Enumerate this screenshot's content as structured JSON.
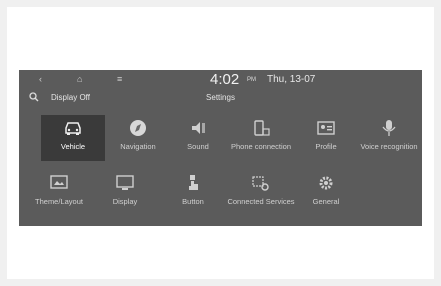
{
  "status": {
    "back_icon": "back-icon",
    "home_icon": "home-icon",
    "menu_icon": "menu-icon",
    "time": "4:02",
    "ampm": "PM",
    "date": "Thu, 13-07"
  },
  "header": {
    "search_icon": "search-icon",
    "display_off": "Display Off",
    "title": "Settings"
  },
  "tiles": [
    {
      "label": "Vehicle",
      "icon": "car-icon",
      "selected": true
    },
    {
      "label": "Navigation",
      "icon": "compass-icon"
    },
    {
      "label": "Sound",
      "icon": "speaker-icon"
    },
    {
      "label": "Phone connection",
      "icon": "phone-icon"
    },
    {
      "label": "Profile",
      "icon": "profile-icon"
    },
    {
      "label": "Voice recognition",
      "icon": "microphone-icon"
    },
    {
      "label": "Theme/Layout",
      "icon": "theme-icon"
    },
    {
      "label": "Display",
      "icon": "display-icon"
    },
    {
      "label": "Button",
      "icon": "button-icon"
    },
    {
      "label": "Connected Services",
      "icon": "connected-services-icon"
    },
    {
      "label": "General",
      "icon": "gear-icon"
    }
  ],
  "colors": {
    "screen_bg": "#5b5b5b",
    "selected_bg": "#3a3a3a",
    "text": "#d0d0d0"
  }
}
